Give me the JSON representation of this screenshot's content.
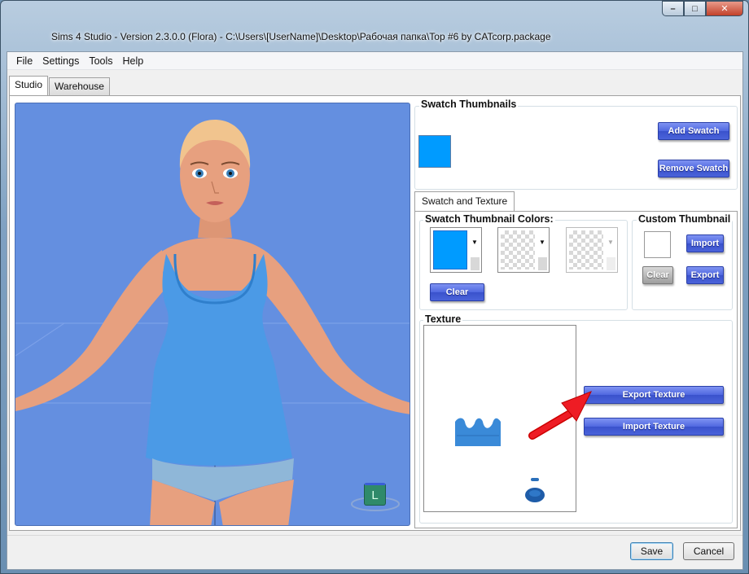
{
  "window": {
    "title": "Sims 4 Studio - Version 2.3.0.0  (Flora)   - C:\\Users\\[UserName]\\Desktop\\Рабочая папка\\Top #6 by CATcorp.package",
    "controls": {
      "minimize": "–",
      "maximize": "□",
      "close": "✕"
    }
  },
  "menu": [
    "File",
    "Settings",
    "Tools",
    "Help"
  ],
  "tabs": {
    "studio": "Studio",
    "warehouse": "Warehouse"
  },
  "viewport": {
    "lod_badge": "L"
  },
  "swatch_thumbnails": {
    "label": "Swatch Thumbnails",
    "swatch_color": "#009bff",
    "add_button": "Add Swatch",
    "remove_button": "Remove Swatch"
  },
  "inner_tab": "Swatch and Texture",
  "thumbnail_colors": {
    "label": "Swatch Thumbnail Colors:",
    "selected_color": "#009bff",
    "clear_button": "Clear"
  },
  "custom_thumbnail": {
    "label": "Custom Thumbnail",
    "import_button": "Import",
    "clear_button": "Clear",
    "export_button": "Export"
  },
  "texture": {
    "label": "Texture",
    "export_button": "Export Texture",
    "import_button": "Import Texture",
    "texture_color": "#3a8ad8"
  },
  "footer": {
    "save": "Save",
    "cancel": "Cancel"
  },
  "colors": {
    "viewport_bg": "#648fe0",
    "button_blue": "#4a63da",
    "arrow_red": "#e8101a"
  }
}
